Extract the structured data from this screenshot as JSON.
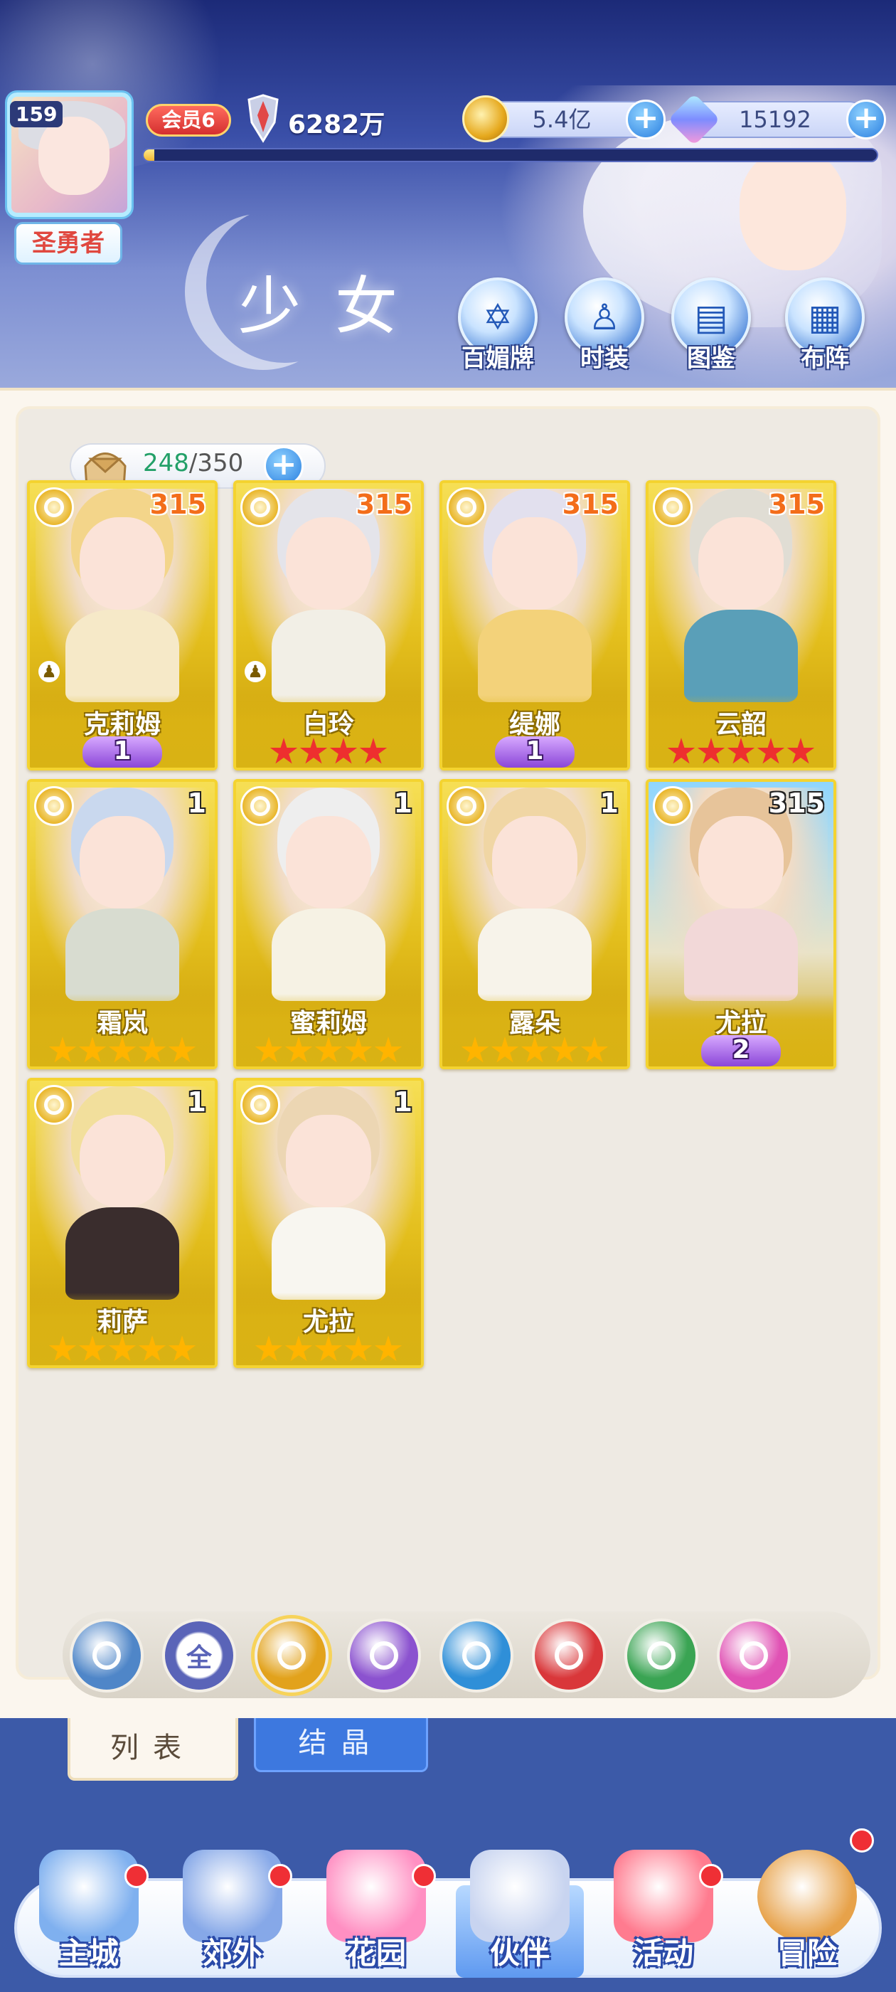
{
  "colors": {
    "accent_blue": "#2a7fe0",
    "card_gold": "#e3be1c",
    "capacity_current": "#23a068",
    "level_orange": "#f36d1a",
    "notification_red": "#ef2f35"
  },
  "player": {
    "level": "159",
    "title": "圣勇者",
    "vip": "会员6",
    "power": "6282万",
    "exp_progress": 0.015
  },
  "resources": {
    "gold": "5.4亿",
    "gems": "15192"
  },
  "header": {
    "page_title": "少女",
    "nav": [
      "百媚牌",
      "时装",
      "图鉴",
      "布阵"
    ]
  },
  "capacity": {
    "current": "248",
    "max": "/350"
  },
  "cards": [
    {
      "name": "克莉姆",
      "level": "315",
      "rank_type": "wing",
      "rank": "1",
      "lock_icon": true,
      "hair": "#f3d58a",
      "cloth": "#f6e9c8"
    },
    {
      "name": "白玲",
      "level": "315",
      "rank_type": "red_stars",
      "stars": 4,
      "lock_icon": true,
      "hair": "#e4e4ea",
      "cloth": "#f2efe6"
    },
    {
      "name": "缇娜",
      "level": "315",
      "rank_type": "wing",
      "rank": "1",
      "lock_icon": false,
      "hair": "#e2e0ee",
      "cloth": "#f3d27a"
    },
    {
      "name": "云韶",
      "level": "315",
      "rank_type": "red_stars",
      "stars": 5,
      "lock_icon": false,
      "hair": "#e0ddd4",
      "cloth": "#5a9fb8"
    },
    {
      "name": "霜岚",
      "level": "1",
      "rank_type": "gold_stars",
      "stars": 5,
      "lock_icon": false,
      "hair": "#c9d8ee",
      "cloth": "#d8dcd0"
    },
    {
      "name": "蜜莉姆",
      "level": "1",
      "rank_type": "gold_stars",
      "stars": 5,
      "lock_icon": false,
      "hair": "#eeeeee",
      "cloth": "#f6f2e4"
    },
    {
      "name": "露朵",
      "level": "1",
      "rank_type": "gold_stars",
      "stars": 5,
      "lock_icon": false,
      "hair": "#f0d6a4",
      "cloth": "#f7f3ea"
    },
    {
      "name": "尤拉",
      "level": "315",
      "rank_type": "wing",
      "rank": "2",
      "lock_icon": false,
      "hair": "#e7c49a",
      "cloth": "#f2d8d8"
    },
    {
      "name": "莉萨",
      "level": "1",
      "rank_type": "gold_stars",
      "stars": 5,
      "lock_icon": false,
      "hair": "#f2df9c",
      "cloth": "#3a2d2d"
    },
    {
      "name": "尤拉",
      "level": "1",
      "rank_type": "gold_stars",
      "stars": 5,
      "lock_icon": false,
      "hair": "#ecd6b3",
      "cloth": "#f8f6f0"
    }
  ],
  "filters": [
    {
      "name": "wind",
      "label": "",
      "color": "#4f86c8"
    },
    {
      "name": "all",
      "label": "全",
      "color": "#5a64b8"
    },
    {
      "name": "light",
      "label": "",
      "color": "#e2a21c",
      "selected": true
    },
    {
      "name": "moon",
      "label": "",
      "color": "#8b52cf"
    },
    {
      "name": "water",
      "label": "",
      "color": "#2f8fd8"
    },
    {
      "name": "fire",
      "label": "",
      "color": "#d9373a"
    },
    {
      "name": "nature",
      "label": "",
      "color": "#3aa453"
    },
    {
      "name": "arcane",
      "label": "",
      "color": "#e052b4"
    }
  ],
  "tabs": {
    "list": "列表",
    "crystal": "结晶"
  },
  "bottom_nav": [
    {
      "label": "主城",
      "notify": true,
      "color": "#7fb0ef"
    },
    {
      "label": "郊外",
      "notify": true,
      "color": "#86a8e8"
    },
    {
      "label": "花园",
      "notify": true,
      "color": "#ff8fc2"
    },
    {
      "label": "伙伴",
      "notify": false,
      "color": "#c8d4f0",
      "active": true
    },
    {
      "label": "活动",
      "notify": true,
      "color": "#ff7b8f"
    },
    {
      "label": "冒险",
      "notify": true,
      "color": "#e7a24a"
    }
  ]
}
